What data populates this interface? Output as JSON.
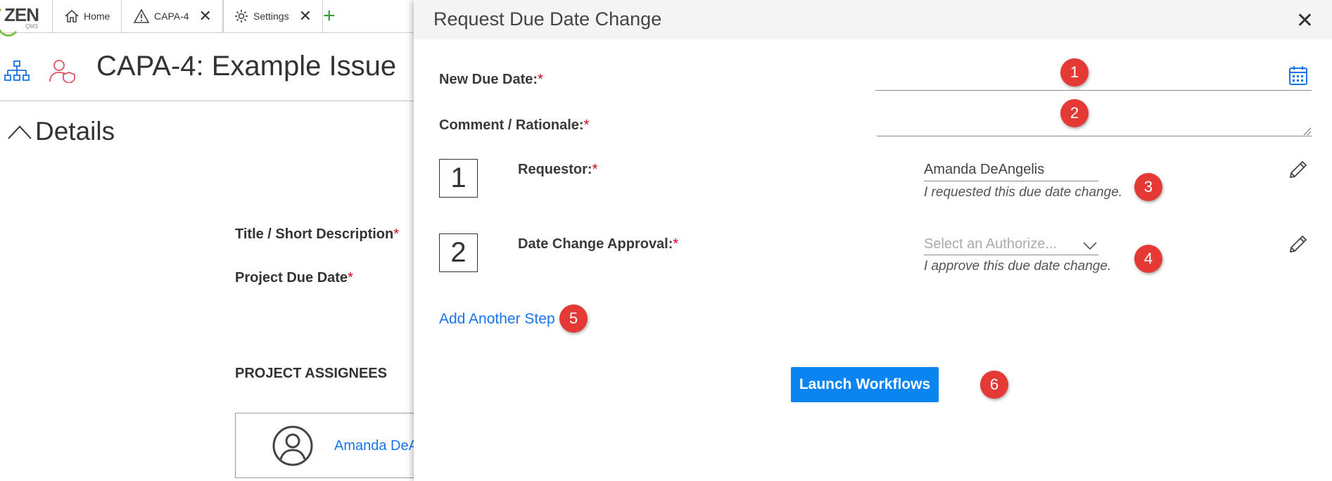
{
  "tabs": [
    {
      "label": "Home",
      "icon": "home-icon"
    },
    {
      "label": "CAPA-4",
      "icon": "warning-icon",
      "closable": true
    },
    {
      "label": "Settings",
      "icon": "gear-icon",
      "closable": true
    }
  ],
  "logo": {
    "brand": "ZEN",
    "sub": "QMS"
  },
  "page": {
    "title": "CAPA-4: Example Issue",
    "section": "Details",
    "fields": {
      "title_label": "Title / Short Description",
      "due_label": "Project Due Date",
      "required_mark": "*"
    },
    "assignees_heading": "PROJECT ASSIGNEES",
    "assignee_name": "Amanda DeA"
  },
  "modal": {
    "title": "Request Due Date Change",
    "new_due_label": "New Due Date:",
    "new_due_value": "",
    "comment_label": "Comment / Rationale:",
    "comment_value": "",
    "required_mark": "*",
    "steps": [
      {
        "number": "1",
        "label": "Requestor:",
        "value": "Amanda DeAngelis",
        "note": "I requested this due date change."
      },
      {
        "number": "2",
        "label": "Date Change Approval:",
        "placeholder": "Select an Authorize...",
        "note": "I approve this due date change."
      }
    ],
    "add_step_label": "Add Another Step",
    "launch_label": "Launch Workflows"
  },
  "callouts": [
    "1",
    "2",
    "3",
    "4",
    "5",
    "6"
  ],
  "colors": {
    "accent": "#0a84f0",
    "link": "#1a73e8",
    "badge": "#e53935",
    "required": "#d0021b",
    "brand_green": "#7dc142"
  }
}
